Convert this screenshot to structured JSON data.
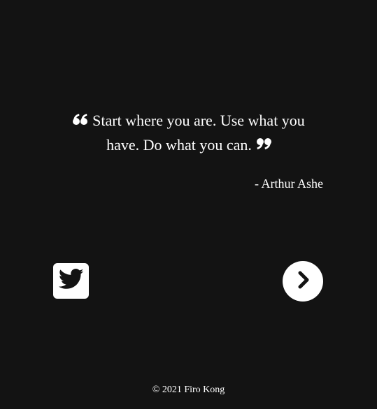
{
  "colors": {
    "background": "#131313",
    "text": "#ffffff",
    "button_bg": "#ffffff",
    "icon": "#131313"
  },
  "quote": {
    "text": "Start where you are. Use what you have. Do what you can.",
    "author": "- Arthur Ashe",
    "open_icon": "quote-left-icon",
    "close_icon": "quote-right-icon"
  },
  "actions": {
    "tweet_icon": "twitter-icon",
    "next_icon": "chevron-right-icon"
  },
  "footer": {
    "copyright": "© 2021 Firo Kong"
  }
}
